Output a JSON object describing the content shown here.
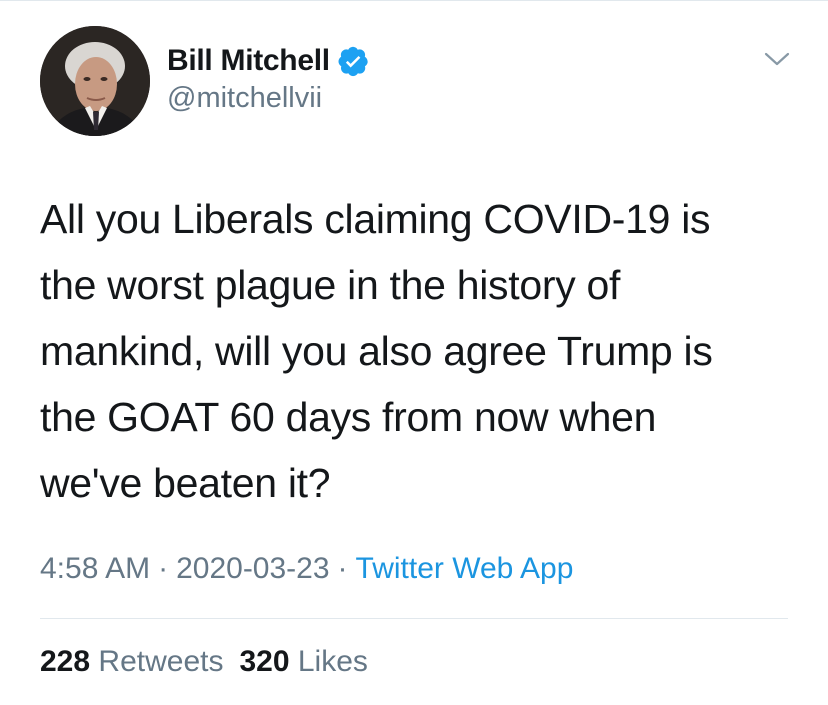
{
  "author": {
    "display_name": "Bill Mitchell",
    "handle": "@mitchellvii",
    "verified": true
  },
  "tweet": {
    "text": "All you Liberals claiming COVID-19 is\nthe worst plague in the history of\nmankind, will you also agree Trump is\nthe GOAT 60 days from now when\nwe've beaten it?",
    "time": "4:58 AM",
    "separator": "·",
    "date": "2020-03-23",
    "source": "Twitter Web App"
  },
  "stats": {
    "retweets_count": "228",
    "retweets_label": "Retweets",
    "likes_count": "320",
    "likes_label": "Likes"
  },
  "icons": {
    "verified": "verified-badge-icon",
    "menu": "chevron-down-icon"
  },
  "colors": {
    "text_primary": "#14171a",
    "text_secondary": "#657786",
    "link": "#1b95e0",
    "verified_blue": "#1da1f2",
    "divider": "#e1e8ed"
  }
}
